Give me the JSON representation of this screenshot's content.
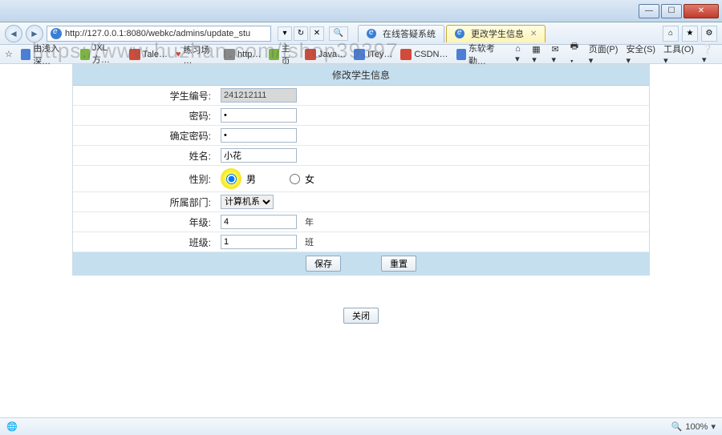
{
  "window": {
    "min": "—",
    "max": "☐",
    "close": "✕"
  },
  "nav": {
    "back": "◄",
    "fwd": "►",
    "url": "http://127.0.0.1:8080/webkc/admins/update_stu",
    "refresh": "↻",
    "stop": "✕",
    "search_icon": "🔍"
  },
  "tabs": [
    {
      "icon": "🌐",
      "label": "在线答疑系统"
    },
    {
      "icon": "🌐",
      "label": "更改学生信息"
    }
  ],
  "right_icons": {
    "home": "⌂",
    "star": "★",
    "gear": "⚙"
  },
  "bookmarks": {
    "star": "☆",
    "items": [
      {
        "cls": "b",
        "label": "由浅入深…"
      },
      {
        "cls": "g",
        "label": "JXL方…"
      },
      {
        "cls": "r",
        "label": "Tale…"
      },
      {
        "cls": "r",
        "label": "练习场 …"
      },
      {
        "cls": "gr",
        "label": "http…"
      },
      {
        "cls": "g",
        "label": "主页"
      },
      {
        "cls": "r",
        "label": "Java…"
      },
      {
        "cls": "b",
        "label": "ITey…"
      },
      {
        "cls": "r",
        "label": "CSDN…"
      },
      {
        "cls": "b",
        "label": "东软考勤…"
      }
    ],
    "right": {
      "home": "⌂ ▾",
      "rss": "▦ ▾",
      "mail": "✉ ▾",
      "print": "🖶 ▾",
      "page": "页面(P) ▾",
      "safety": "安全(S) ▾",
      "tools": "工具(O) ▾",
      "help": "❔ ▾"
    }
  },
  "watermark": "https://www.huzhan.com/ishop39397",
  "form": {
    "title": "修改学生信息",
    "student_id_label": "学生编号:",
    "student_id_value": "241212111",
    "password_label": "密码:",
    "password_value": "•",
    "confirm_label": "确定密码:",
    "confirm_value": "•",
    "name_label": "姓名:",
    "name_value": "小花",
    "gender_label": "性别:",
    "gender_male": "男",
    "gender_female": "女",
    "dept_label": "所属部门:",
    "dept_value": "计算机系",
    "grade_label": "年级:",
    "grade_value": "4",
    "grade_suffix": "年",
    "class_label": "班级:",
    "class_value": "1",
    "class_suffix": "班",
    "save": "保存",
    "reset": "重置",
    "close": "关闭"
  },
  "status": {
    "globe": "🌐",
    "zoom": "100%",
    "dd": "▾"
  }
}
